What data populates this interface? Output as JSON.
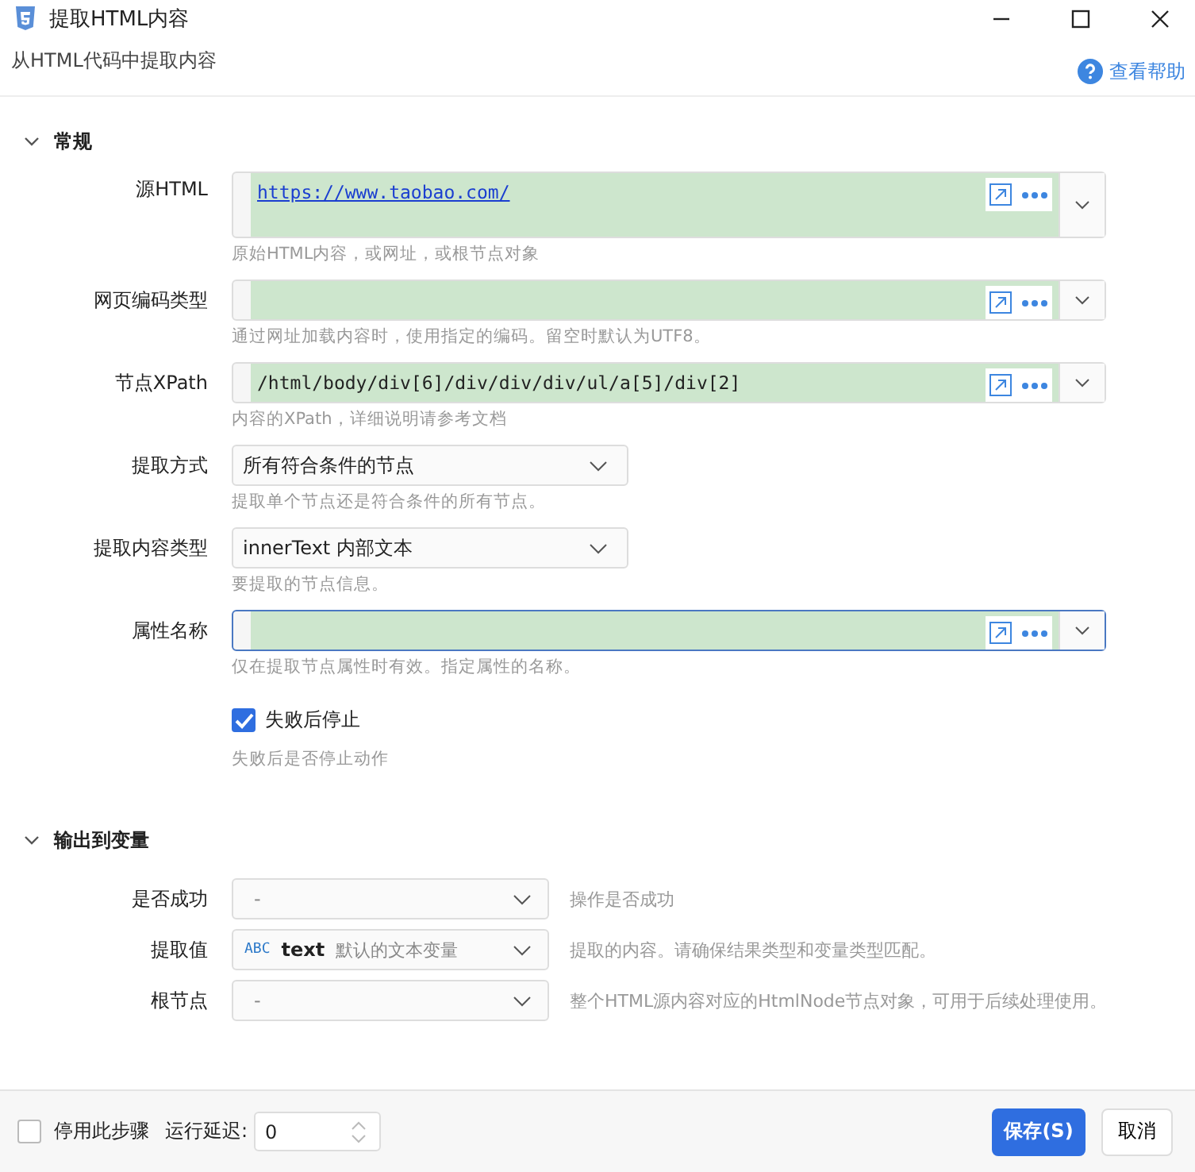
{
  "window": {
    "title": "提取HTML内容",
    "subtitle": "从HTML代码中提取内容",
    "help": "查看帮助"
  },
  "general": {
    "title": "常规",
    "expanded": true,
    "fields": [
      {
        "kind": "multiline",
        "label": "源HTML",
        "value": "https://www.taobao.com/",
        "is_link": true,
        "focused": false,
        "hint": "原始HTML内容，或网址，或根节点对象"
      },
      {
        "kind": "expression",
        "label": "网页编码类型",
        "focused": false,
        "hint": "通过网址加载内容时，使用指定的编码。留空时默认为UTF8。"
      },
      {
        "kind": "expression",
        "label": "节点XPath",
        "value": "/html/body/div[6]/div/div/div/ul/a[5]/div[2]",
        "is_link": false,
        "focused": false,
        "hint": "内容的XPath，详细说明请参考文档"
      },
      {
        "kind": "select",
        "label": "提取方式",
        "value": "所有符合条件的节点",
        "focused": false,
        "hint": "提取单个节点还是符合条件的所有节点。"
      },
      {
        "kind": "select",
        "label": "提取内容类型",
        "value": "innerText 内部文本",
        "focused": false,
        "hint": "要提取的节点信息。"
      },
      {
        "kind": "expression",
        "label": "属性名称",
        "focused": true,
        "hint": "仅在提取节点属性时有效。指定属性的名称。"
      }
    ],
    "checkbox": {
      "label": "失败后停止",
      "checked": true,
      "hint": "失败后是否停止动作"
    }
  },
  "output": {
    "title": "输出到变量",
    "expanded": true,
    "rows": [
      {
        "label": "是否成功",
        "value": "-",
        "hint": "操作是否成功"
      },
      {
        "label": "提取值",
        "type_badge": "ABC",
        "value": "text",
        "description": "默认的文本变量",
        "hint": "提取的内容。请确保结果类型和变量类型匹配。"
      },
      {
        "label": "根节点",
        "value": "-",
        "hint": "整个HTML源内容对应的HtmlNode节点对象，可用于后续处理使用。"
      }
    ]
  },
  "footer": {
    "disable": {
      "label": "停用此步骤",
      "checked": false
    },
    "delay_label": "运行延迟:",
    "delay_value": "0",
    "save": "保存(S)",
    "cancel": "取消"
  }
}
